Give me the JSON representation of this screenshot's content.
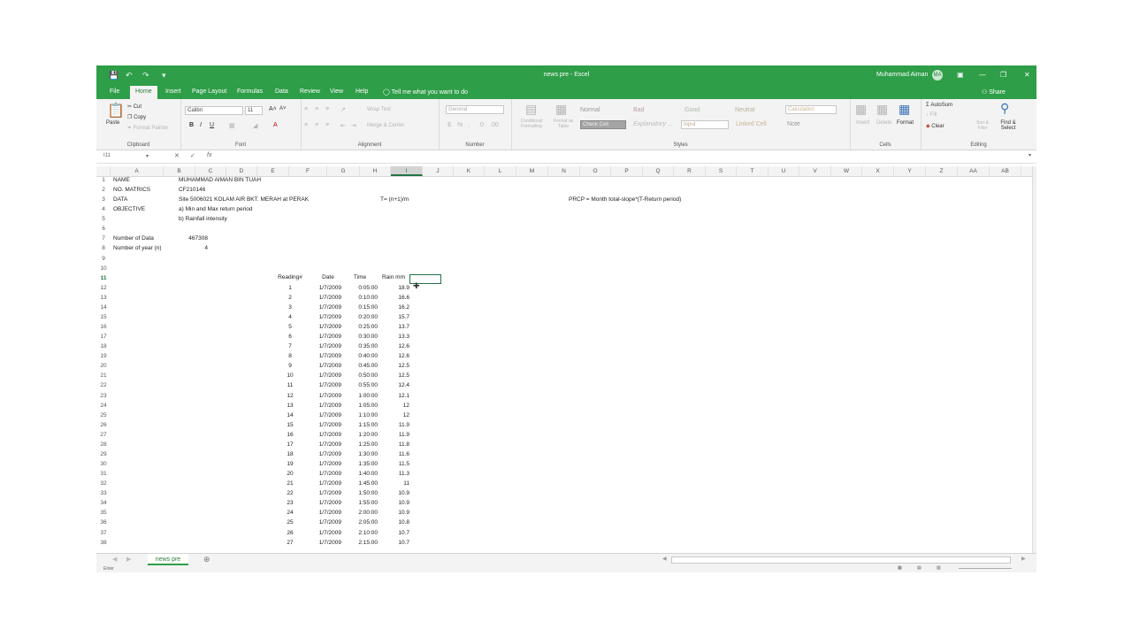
{
  "window": {
    "title": "news pre - Excel",
    "user": "Muhammad Aiman",
    "user_initials": "MA",
    "accent": "#2e9e48"
  },
  "ribbon_tabs": [
    "File",
    "Home",
    "Insert",
    "Page Layout",
    "Formulas",
    "Data",
    "Review",
    "View",
    "Help"
  ],
  "tell_me": "Tell me what you want to do",
  "share": "Share",
  "clipboard": {
    "paste": "Paste",
    "cut": "Cut",
    "copy": "Copy",
    "format_painter": "Format Painter",
    "label": "Clipboard"
  },
  "font": {
    "name": "Calibri",
    "size": "11",
    "label": "Font"
  },
  "alignment": {
    "wrap": "Wrap Text",
    "merge": "Merge & Center",
    "label": "Alignment"
  },
  "number": {
    "format": "General",
    "label": "Number"
  },
  "styles": {
    "conditional": "Conditional Formatting",
    "format_table": "Format as Table",
    "items": [
      "Normal",
      "Bad",
      "Good",
      "Neutral",
      "Calculation",
      "Check Cell",
      "Explanatory ...",
      "Input",
      "Linked Cell",
      "Note"
    ],
    "label": "Styles"
  },
  "cells": {
    "insert": "Insert",
    "delete": "Delete",
    "format": "Format",
    "label": "Cells"
  },
  "editing": {
    "autosum": "AutoSum",
    "fill": "Fill",
    "clear": "Clear",
    "sort": "Sort & Filter",
    "find": "Find & Select",
    "label": "Editing"
  },
  "formula_bar": {
    "name_box": "I11",
    "content": ""
  },
  "columns": [
    "A",
    "B",
    "C",
    "D",
    "E",
    "F",
    "G",
    "H",
    "I",
    "J",
    "K",
    "L",
    "M",
    "N",
    "O",
    "P",
    "Q",
    "R",
    "S",
    "T",
    "U",
    "V",
    "W",
    "X",
    "Y",
    "Z",
    "AA",
    "AB"
  ],
  "info": {
    "name_label": "NAME",
    "name": "MUHAMMAD AIMAN BIN TUAH",
    "matrics_label": "NO. MATRICS",
    "matrics": "CF210146",
    "data_label": "DATA",
    "data": "Site 5006021 KOLAM AIR BKT. MERAH at PERAK",
    "formula_t": "T= (n+1)/m",
    "formula_prcp": "PRCP = Month total-slope*(T-Return period)",
    "objective_label": "OBJECTIVE",
    "objective_a": "a) Min and Max return period",
    "objective_b": "b) Rainfall intensity",
    "num_data_label": "Number of Data",
    "num_data": "467308",
    "num_year_label": "Number of year (n)",
    "num_year": "4"
  },
  "table": {
    "headers": [
      "Reading#",
      "Date",
      "Time",
      "Rain mm"
    ],
    "rows": [
      [
        "1",
        "1/7/2009",
        "0:05:00",
        "18.9"
      ],
      [
        "2",
        "1/7/2009",
        "0:10:00",
        "16.6"
      ],
      [
        "3",
        "1/7/2009",
        "0:15:00",
        "16.2"
      ],
      [
        "4",
        "1/7/2009",
        "0:20:00",
        "15.7"
      ],
      [
        "5",
        "1/7/2009",
        "0:25:00",
        "13.7"
      ],
      [
        "6",
        "1/7/2009",
        "0:30:00",
        "13.3"
      ],
      [
        "7",
        "1/7/2009",
        "0:35:00",
        "12.6"
      ],
      [
        "8",
        "1/7/2009",
        "0:40:00",
        "12.6"
      ],
      [
        "9",
        "1/7/2009",
        "0:45:00",
        "12.5"
      ],
      [
        "10",
        "1/7/2009",
        "0:50:00",
        "12.5"
      ],
      [
        "11",
        "1/7/2009",
        "0:55:00",
        "12.4"
      ],
      [
        "12",
        "1/7/2009",
        "1:00:00",
        "12.1"
      ],
      [
        "13",
        "1/7/2009",
        "1:05:00",
        "12"
      ],
      [
        "14",
        "1/7/2009",
        "1:10:00",
        "12"
      ],
      [
        "15",
        "1/7/2009",
        "1:15:00",
        "11.9"
      ],
      [
        "16",
        "1/7/2009",
        "1:20:00",
        "11.9"
      ],
      [
        "17",
        "1/7/2009",
        "1:25:00",
        "11.8"
      ],
      [
        "18",
        "1/7/2009",
        "1:30:00",
        "11.6"
      ],
      [
        "19",
        "1/7/2009",
        "1:35:00",
        "11.5"
      ],
      [
        "20",
        "1/7/2009",
        "1:40:00",
        "11.3"
      ],
      [
        "21",
        "1/7/2009",
        "1:45:00",
        "11"
      ],
      [
        "22",
        "1/7/2009",
        "1:50:00",
        "10.9"
      ],
      [
        "23",
        "1/7/2009",
        "1:55:00",
        "10.9"
      ],
      [
        "24",
        "1/7/2009",
        "2:00:00",
        "10.9"
      ],
      [
        "25",
        "1/7/2009",
        "2:05:00",
        "10.8"
      ],
      [
        "26",
        "1/7/2009",
        "2:10:00",
        "10.7"
      ],
      [
        "27",
        "1/7/2009",
        "2:15:00",
        "10.7"
      ]
    ]
  },
  "sheet_tab": "news pre",
  "status": "Enter"
}
